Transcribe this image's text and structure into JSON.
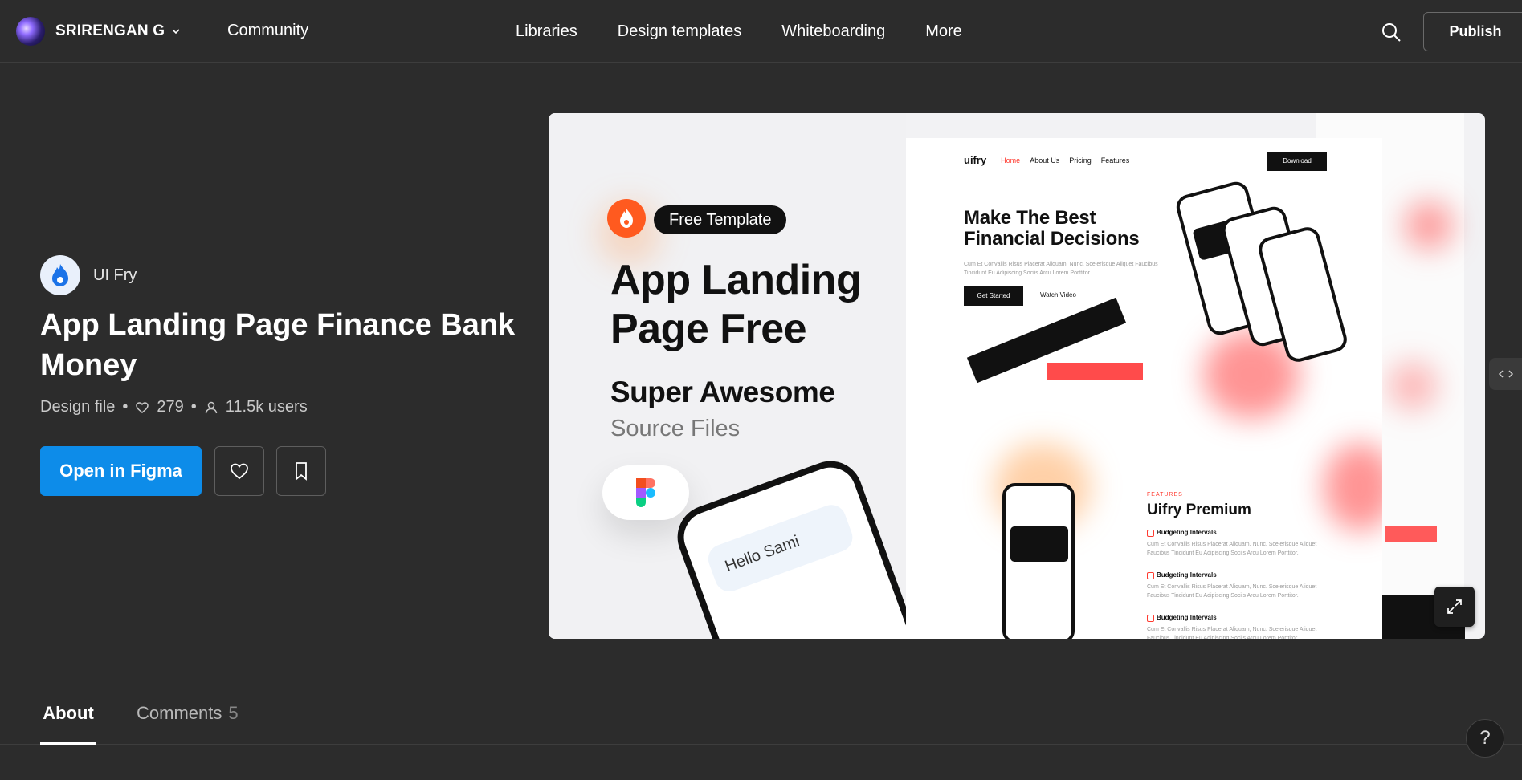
{
  "nav": {
    "account_name": "SRIRENGAN G",
    "community": "Community",
    "links": [
      "Libraries",
      "Design templates",
      "Whiteboarding",
      "More"
    ],
    "publish": "Publish"
  },
  "file": {
    "author": "UI Fry",
    "title": "App Landing Page Finance Bank Money",
    "type": "Design file",
    "likes": "279",
    "users": "11.5k users",
    "open_label": "Open in Figma"
  },
  "preview": {
    "badge": "Free Template",
    "headline": "App Landing Page Free",
    "sub1": "Super Awesome",
    "sub2": "Source Files",
    "site": {
      "logo": "uifry",
      "nav": [
        "Home",
        "About Us",
        "Pricing",
        "Features"
      ],
      "download": "Download",
      "hero": "Make The Best Financial Decisions",
      "hero_text": "Cum Et Convallis Risus Placerat Aliquam, Nunc. Scelerisque Aliquet Faucibus Tincidunt Eu Adipiscing Sociis Arcu Lorem Porttitor.",
      "get_started": "Get Started",
      "watch_video": "Watch Video",
      "hello": "Hello Sami",
      "features_tag": "FEATURES",
      "features_title": "Uifry Premium",
      "features": [
        {
          "title": "Budgeting Intervals",
          "desc": "Cum Et Convallis Risus Placerat Aliquam, Nunc. Scelerisque Aliquet Faucibus Tincidunt Eu Adipiscing Sociis Arcu Lorem Porttitor."
        },
        {
          "title": "Budgeting Intervals",
          "desc": "Cum Et Convallis Risus Placerat Aliquam, Nunc. Scelerisque Aliquet Faucibus Tincidunt Eu Adipiscing Sociis Arcu Lorem Porttitor."
        },
        {
          "title": "Budgeting Intervals",
          "desc": "Cum Et Convallis Risus Placerat Aliquam, Nunc. Scelerisque Aliquet Faucibus Tincidunt Eu Adipiscing Sociis Arcu Lorem Porttitor."
        }
      ]
    }
  },
  "tabs": {
    "about": "About",
    "comments": "Comments",
    "comments_count": "5"
  },
  "help": "?",
  "colors": {
    "background": "#2c2c2c",
    "primary_button": "#0d8ce9",
    "accent_red": "#ff3b30",
    "flame_orange": "#ff5a1f"
  },
  "icons": [
    "chevron-down-icon",
    "search-icon",
    "heart-icon",
    "user-icon",
    "bookmark-icon",
    "expand-icon",
    "flame-icon",
    "figma-icon"
  ]
}
